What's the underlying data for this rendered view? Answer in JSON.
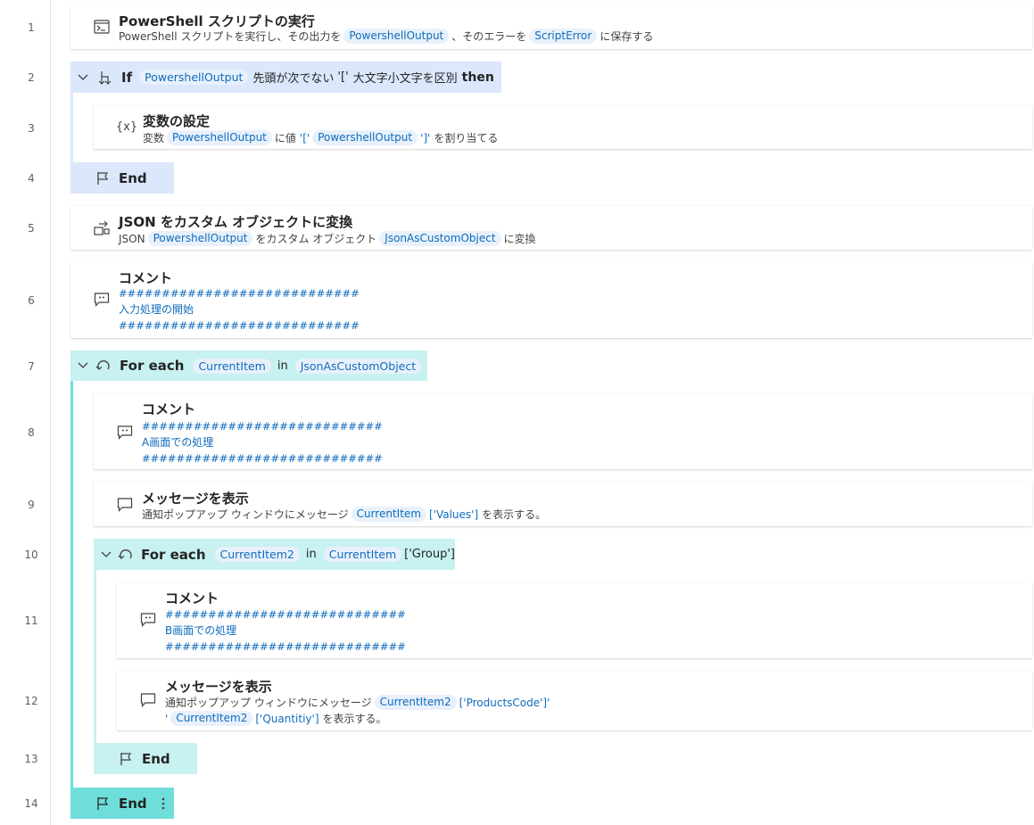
{
  "colors": {
    "if_block": "#dbe7fb",
    "loop_block": "#c8f1f1",
    "loop_end_active": "#6fdedb",
    "token_bg": "#e8f1fb",
    "token_text": "#0f6cbd"
  },
  "line_numbers": [
    "1",
    "2",
    "3",
    "4",
    "5",
    "6",
    "7",
    "8",
    "9",
    "10",
    "11",
    "12",
    "13",
    "14"
  ],
  "steps": {
    "s1": {
      "icon": "terminal-icon",
      "title": "PowerShell スクリプトの実行",
      "desc": {
        "p1": "PowerShell スクリプトを実行し、その出力を",
        "t1": "PowershellOutput",
        "p2": "、そのエラーを",
        "t2": "ScriptError",
        "p3": "に保存する"
      }
    },
    "s2": {
      "icon": "if-branch-icon",
      "keyword": "If",
      "var": "PowershellOutput",
      "condition": "先頭が次でない",
      "value": "'['",
      "option": "大文字小文字を区別",
      "then": "then"
    },
    "s3": {
      "icon": "variable-icon",
      "icon_text": "{x}",
      "title": "変数の設定",
      "desc": {
        "p1": "変数",
        "t1": "PowershellOutput",
        "p2": "に値",
        "q1": "'['",
        "t2": "PowershellOutput",
        "q2": "']'",
        "p3": "を割り当てる"
      }
    },
    "s4": {
      "icon": "flag-icon",
      "label": "End"
    },
    "s5": {
      "icon": "convert-icon",
      "title": "JSON をカスタム オブジェクトに変換",
      "desc": {
        "p1": "JSON",
        "t1": "PowershellOutput",
        "p2": "をカスタム オブジェクト",
        "t2": "JsonAsCustomObject",
        "p3": "に変換"
      }
    },
    "s6": {
      "icon": "comment-icon",
      "title": "コメント",
      "lines": [
        "############################",
        "入力処理の開始",
        "############################"
      ]
    },
    "s7": {
      "icon": "loop-icon",
      "keyword": "For each",
      "t1": "CurrentItem",
      "in": "in",
      "t2": "JsonAsCustomObject"
    },
    "s8": {
      "icon": "comment-icon",
      "title": "コメント",
      "lines": [
        "############################",
        "A画面での処理",
        "############################"
      ]
    },
    "s9": {
      "icon": "message-icon",
      "title": "メッセージを表示",
      "desc": {
        "p1": "通知ポップアップ ウィンドウにメッセージ",
        "t1": "CurrentItem",
        "q1": "['Values']",
        "p2": "を表示する。"
      }
    },
    "s10": {
      "icon": "loop-icon",
      "keyword": "For each",
      "t1": "CurrentItem2",
      "in": "in",
      "t2": "CurrentItem",
      "q1": "['Group']"
    },
    "s11": {
      "icon": "comment-icon",
      "title": "コメント",
      "lines": [
        "############################",
        "B画面での処理",
        "############################"
      ]
    },
    "s12": {
      "icon": "message-icon",
      "title": "メッセージを表示",
      "desc": {
        "p1": "通知ポップアップ ウィンドウにメッセージ",
        "t1": "CurrentItem2",
        "q1": "['ProductsCode']'",
        "q2": "'",
        "t2": "CurrentItem2",
        "q3": "['Quantitiy']",
        "p2": "を表示する。"
      }
    },
    "s13": {
      "icon": "flag-icon",
      "label": "End"
    },
    "s14": {
      "icon": "flag-icon",
      "label": "End",
      "menu_icon": "more-vertical-icon"
    }
  }
}
